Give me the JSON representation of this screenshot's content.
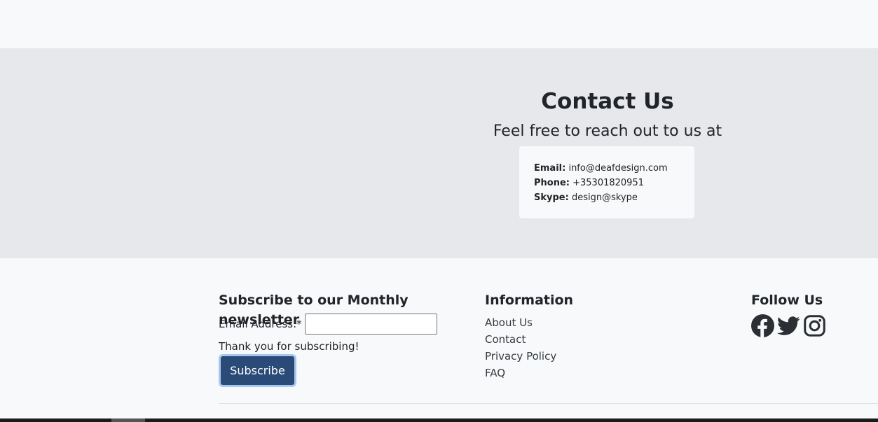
{
  "contact": {
    "title": "Contact Us",
    "subtitle": "Feel free to reach out to us at",
    "email_label": "Email:",
    "email_value": "info@deafdesign.com",
    "phone_label": "Phone:",
    "phone_value": "+35301820951",
    "skype_label": "Skype:",
    "skype_value": "design@skype"
  },
  "newsletter": {
    "heading": "Subscribe to our Monthly newsletter",
    "email_label": "Email Address:*",
    "email_value": "",
    "thanks_text": "Thank you for subscribing!",
    "subscribe_label": "Subscribe"
  },
  "information": {
    "heading": "Information",
    "links": [
      "About Us",
      "Contact",
      "Privacy Policy",
      "FAQ"
    ]
  },
  "follow": {
    "heading": "Follow Us",
    "icons": [
      "facebook-icon",
      "twitter-icon",
      "instagram-icon"
    ]
  },
  "colors": {
    "contact_bg": "#e7e8eb",
    "page_bg": "#f8f9fa",
    "button_bg": "#2a4a78",
    "button_focus_ring": "#a7c7ee"
  }
}
